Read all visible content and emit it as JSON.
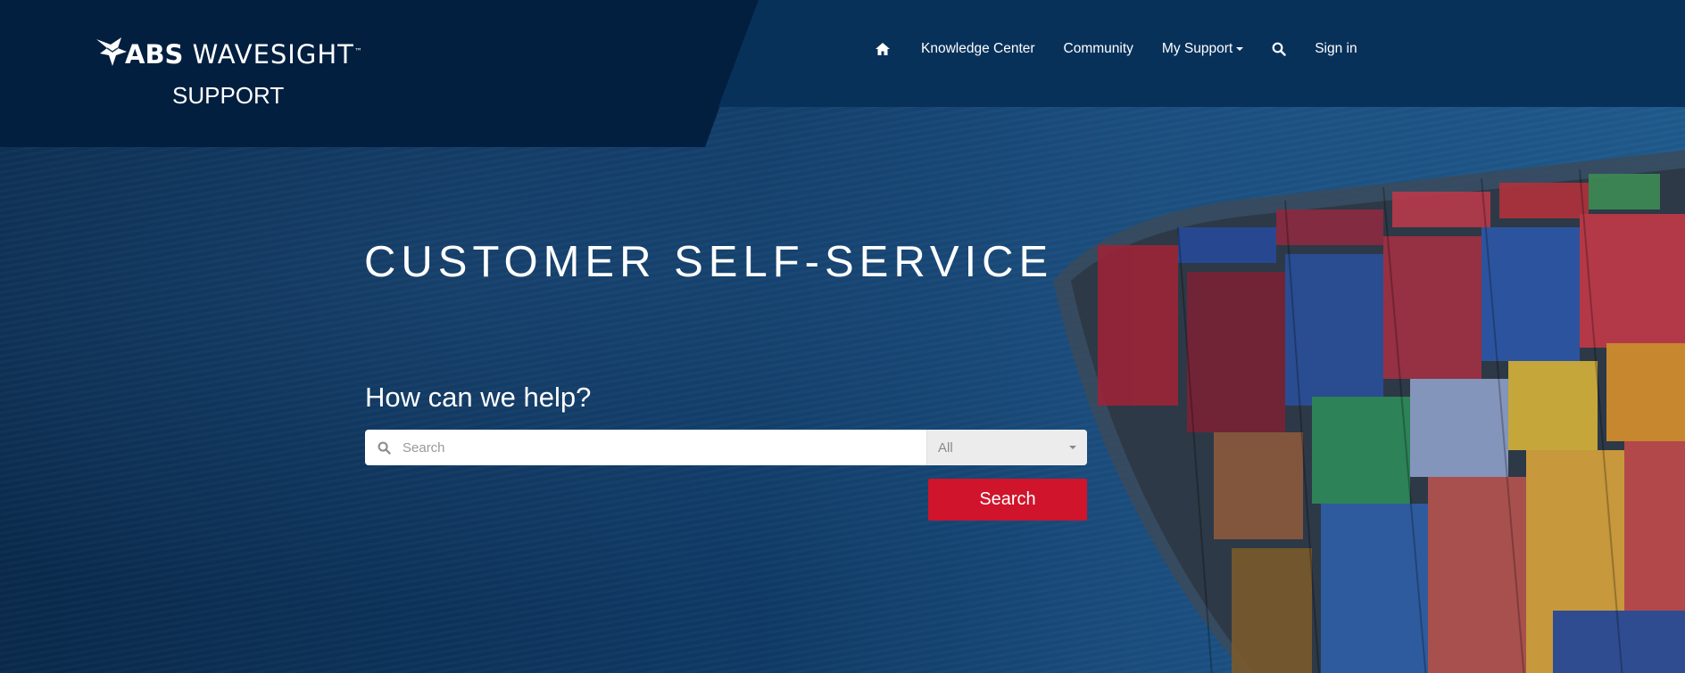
{
  "brand": {
    "logo_icon": "eagle-icon",
    "name_abs": "ABS",
    "name_wavesight": "WAVESIGHT",
    "trademark": "™",
    "support_label": "SUPPORT"
  },
  "nav": {
    "home_icon": "home-icon",
    "items": [
      {
        "label": "Knowledge Center"
      },
      {
        "label": "Community"
      },
      {
        "label": "My Support"
      }
    ],
    "search_icon": "search-icon",
    "sign_in": "Sign in"
  },
  "hero": {
    "title": "CUSTOMER SELF-SERVICE",
    "subtitle": "How can we help?"
  },
  "search": {
    "placeholder": "Search",
    "value": "",
    "scope_selected": "All",
    "button_label": "Search"
  },
  "colors": {
    "logo_panel": "#031f3f",
    "nav_panel": "#08315a",
    "accent_button": "#cf142b",
    "text": "#ffffff"
  }
}
